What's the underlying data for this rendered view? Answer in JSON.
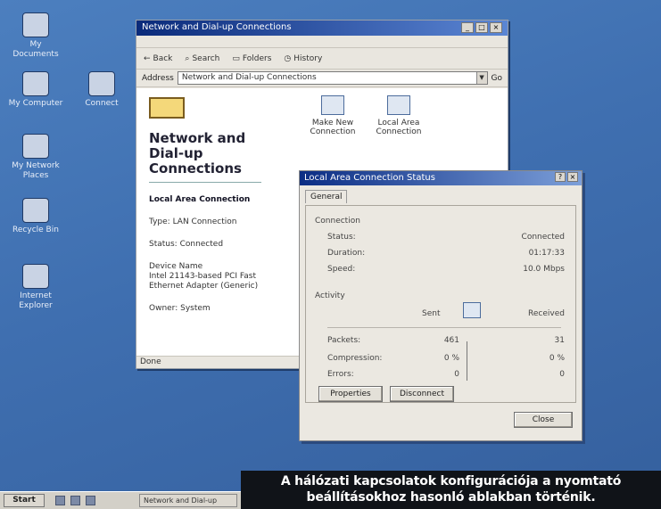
{
  "desktop": {
    "icons": [
      {
        "label": "My Documents",
        "icon": "documents-icon"
      },
      {
        "label": "My Computer",
        "icon": "computer-icon"
      },
      {
        "label": "My Network Places",
        "icon": "network-icon"
      },
      {
        "label": "Recycle Bin",
        "icon": "recycle-bin-icon"
      },
      {
        "label": "Internet Explorer",
        "icon": "browser-icon"
      },
      {
        "label": "Connect",
        "icon": "connect-icon"
      }
    ]
  },
  "window": {
    "title": "Network and Dial-up Connections",
    "toolbar": {
      "back": "Back",
      "search": "Search",
      "folders": "Folders",
      "history": "History"
    },
    "address": {
      "label": "Address",
      "value": "Network and Dial-up Connections",
      "go": "Go"
    },
    "left_pane": {
      "title": "Network and Dial-up Connections",
      "selected_name": "Local Area Connection",
      "type": "Type: LAN Connection",
      "status": "Status: Connected",
      "device_label": "Device Name",
      "device_name": "Intel 21143-based PCI Fast Ethernet Adapter (Generic)",
      "owner": "Owner: System"
    },
    "items": [
      {
        "label": "Make New Connection"
      },
      {
        "label": "Local Area Connection"
      }
    ],
    "statusbar": "Done"
  },
  "dialog": {
    "title": "Local Area Connection Status",
    "tab": "General",
    "connection": {
      "header": "Connection",
      "status_label": "Status:",
      "status_value": "Connected",
      "duration_label": "Duration:",
      "duration_value": "01:17:33",
      "speed_label": "Speed:",
      "speed_value": "10.0 Mbps"
    },
    "activity": {
      "header": "Activity",
      "sent": "Sent",
      "received": "Received",
      "packets_label": "Packets:",
      "packets_sent": "461",
      "packets_received": "31",
      "compression_label": "Compression:",
      "compression_sent": "0 %",
      "compression_received": "0 %",
      "errors_label": "Errors:",
      "errors_sent": "0",
      "errors_received": "0"
    },
    "buttons": {
      "properties": "Properties",
      "disable": "Disconnect",
      "close": "Close"
    }
  },
  "taskbar": {
    "start": "Start",
    "task": "Network and Dial-up"
  },
  "caption": {
    "line1": "A hálózati kapcsolatok konfigurációja a nyomtató",
    "line2": "beállításokhoz hasonló ablakban történik."
  }
}
